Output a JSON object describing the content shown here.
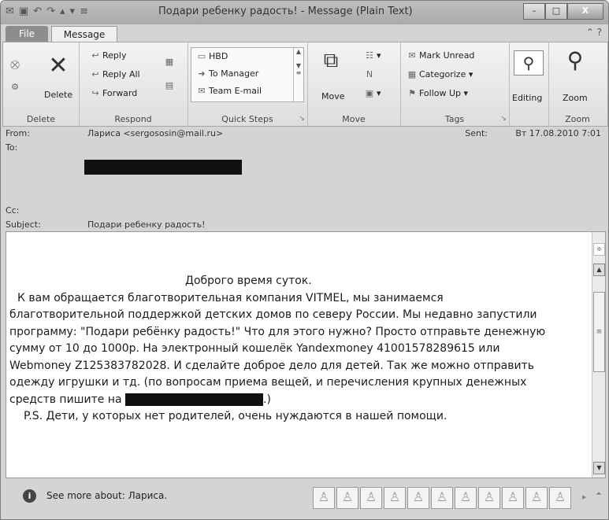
{
  "window": {
    "title": "Подари ребенку радость! - Message (Plain Text)",
    "controls": [
      "–",
      "□",
      "X"
    ]
  },
  "tabs": {
    "file": "File",
    "message": "Message"
  },
  "ribbon": {
    "delete": {
      "delete_label": "Delete",
      "group_label": "Delete"
    },
    "respond": {
      "reply": "Reply",
      "reply_all": "Reply All",
      "forward": "Forward",
      "group_label": "Respond"
    },
    "quick_steps": {
      "items": [
        "HBD",
        "To Manager",
        "Team E-mail"
      ],
      "group_label": "Quick Steps"
    },
    "move": {
      "move_label": "Move",
      "group_label": "Move"
    },
    "tags": {
      "mark_unread": "Mark Unread",
      "categorize": "Categorize",
      "follow_up": "Follow Up",
      "group_label": "Tags"
    },
    "editing": {
      "label": "Editing"
    },
    "zoom": {
      "label": "Zoom",
      "group_label": "Zoom"
    }
  },
  "header": {
    "from_label": "From:",
    "from_value": "Лариса <sergososin@mail.ru>",
    "to_label": "To:",
    "cc_label": "Cc:",
    "subject_label": "Subject:",
    "subject_value": "Подари ребенку радость!",
    "sent_label": "Sent:",
    "sent_value": "Вт 17.08.2010 7:01"
  },
  "message": {
    "greeting": "Доброго время суток.",
    "lines": [
      "К вам обращается благотворительная компания VITMEL, мы занимаемся",
      "благотворительной поддержкой детских домов по северу России. Мы недавно запустили",
      "программу: \"Подари ребёнку радость!\" Что для этого нужно? Просто отправьте денежную",
      "сумму от 10 до 1000р. На электронный кошелёк Yandexmoney 41001578289615 или",
      "Webmoney Z125383782028. И сделайте доброе дело для детей. Так же можно отправить",
      "одежду  игрушки и тд. (по вопросам приема вещей, и перечисления крупных денежных"
    ],
    "contact_prefix": "средств пишите на",
    "contact_suffix": ".)",
    "ps": "P.S.  Дети, у которых нет родителей, очень нуждаются в нашей помощи."
  },
  "people_pane": {
    "text": "See more about: Лариса."
  },
  "colors": {
    "redaction": "#111111",
    "ribbon": "#e8e8e8",
    "titlebar": "#b3b3b3"
  }
}
